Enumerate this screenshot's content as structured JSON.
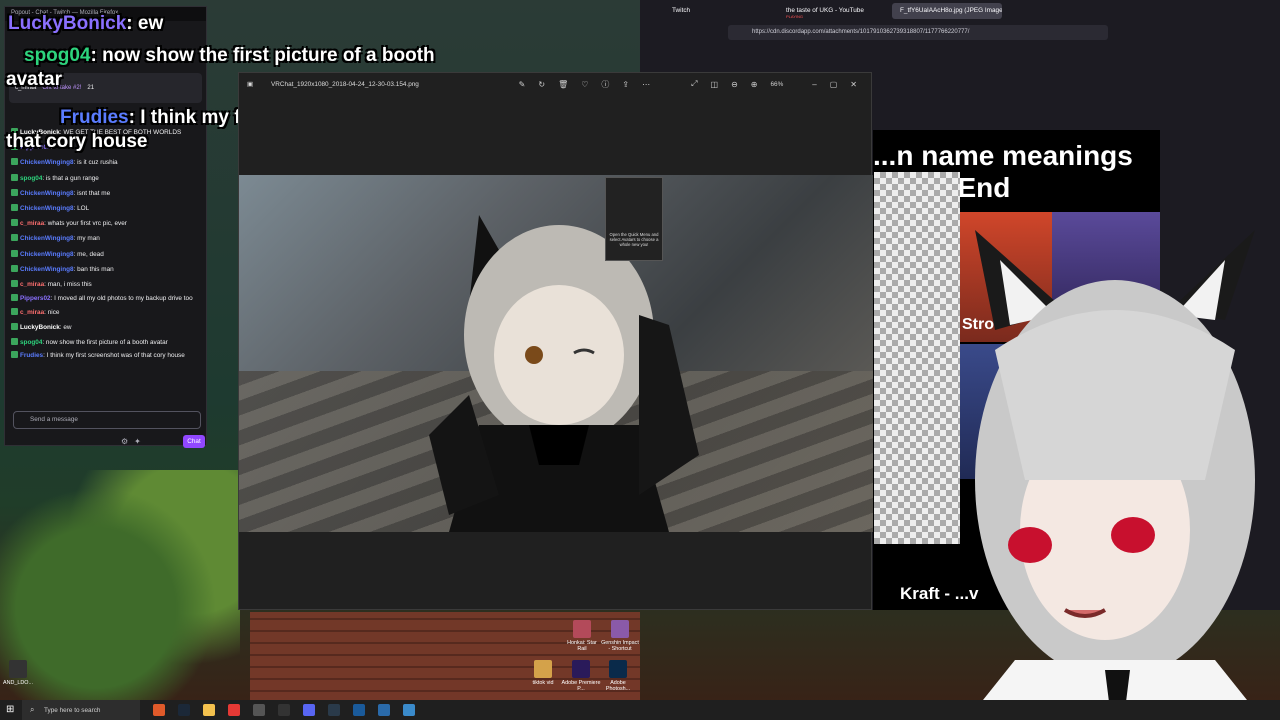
{
  "chat_window": {
    "title": "Popout - Chat - Twitch — Mozilla Firefox",
    "pinned_user": "c_miraa",
    "pinned_gift": "Gift to take #2!",
    "pinned_count": "21",
    "input_placeholder": "Send a message",
    "chat_button": "Chat",
    "messages": [
      {
        "user": "LuckyBonick",
        "text": "WE GET THE BEST OF BOTH WORLDS",
        "color": "#ffffff"
      },
      {
        "user": "Pippers02",
        "text": "",
        "color": "#8a70ff"
      },
      {
        "user": "ChickenWinging8",
        "text": "is it cuz rushia",
        "color": "#5a7cff"
      },
      {
        "user": "spog04",
        "text": "is that a gun range",
        "color": "#2dd47d"
      },
      {
        "user": "ChickenWinging8",
        "text": "isnt that me",
        "color": "#5a7cff"
      },
      {
        "user": "ChickenWinging8",
        "text": "LOL",
        "color": "#5a7cff"
      },
      {
        "user": "c_miraa",
        "text": "whats your first vrc pic, ever",
        "color": "#ff6f6f"
      },
      {
        "user": "ChickenWinging8",
        "text": "my man",
        "color": "#5a7cff"
      },
      {
        "user": "ChickenWinging8",
        "text": "me, dead",
        "color": "#5a7cff"
      },
      {
        "user": "ChickenWinging8",
        "text": "ban this man",
        "color": "#5a7cff"
      },
      {
        "user": "c_miraa",
        "text": "man, i miss this",
        "color": "#ff6f6f"
      },
      {
        "user": "Pippers02",
        "text": "I moved all my old photos to my backup drive too",
        "color": "#8a70ff"
      },
      {
        "user": "c_miraa",
        "text": "nice",
        "color": "#ff6f6f"
      },
      {
        "user": "LuckyBonick",
        "text": "ew",
        "color": "#ffffff"
      },
      {
        "user": "spog04",
        "text": "now show the first picture of a booth avatar",
        "color": "#2dd47d"
      },
      {
        "user": "Frudies",
        "text": "I think my first screenshot was of that cory house",
        "color": "#5a7cff"
      }
    ]
  },
  "overlay": {
    "line1_user": "LuckyBonick",
    "line1_text": ": ew",
    "line2_user": "spog04",
    "line2_text": ": now show the first picture of a booth avatar",
    "line3_user": "Frudies",
    "line3_text": ": I think my first screenshot was of that cory house"
  },
  "viewer": {
    "filename": "VRChat_1920x1080_2018-04-24_12-30-03.154.png",
    "zoom": "66%",
    "sign_text": "Open the Quick Menu and select Avatars to choose a whole new you!"
  },
  "firefox": {
    "tabs": [
      {
        "label": "Twitch",
        "sub": ""
      },
      {
        "label": "the taste of UKG - YouTube",
        "sub": "PLAYING"
      },
      {
        "label": "F_tfY6UaIAAcH8o.jpg (JPEG Image...",
        "sub": ""
      }
    ],
    "url": "https://cdn.discordapp.com/attachments/1017910362739318807/1177766220777/"
  },
  "discord_image": {
    "title": "...n name meanings ...ey's End",
    "label_stro": "Stro",
    "label_d": "D",
    "label_kraft": "Kraft - ...v"
  },
  "desktop": {
    "icons": [
      {
        "label": "Honkai: Star Rail"
      },
      {
        "label": "Genshin Impact - Shortcut"
      },
      {
        "label": "tiktok vid"
      },
      {
        "label": "Adobe Premiere P..."
      },
      {
        "label": "Adobe Photosh..."
      },
      {
        "label": "AND_LDO..."
      }
    ]
  },
  "taskbar": {
    "search_placeholder": "Type here to search"
  },
  "colors": {
    "twitch_purple": "#9147ff",
    "firefox_bg": "#1c1b22",
    "viewer_bg": "#202020"
  }
}
